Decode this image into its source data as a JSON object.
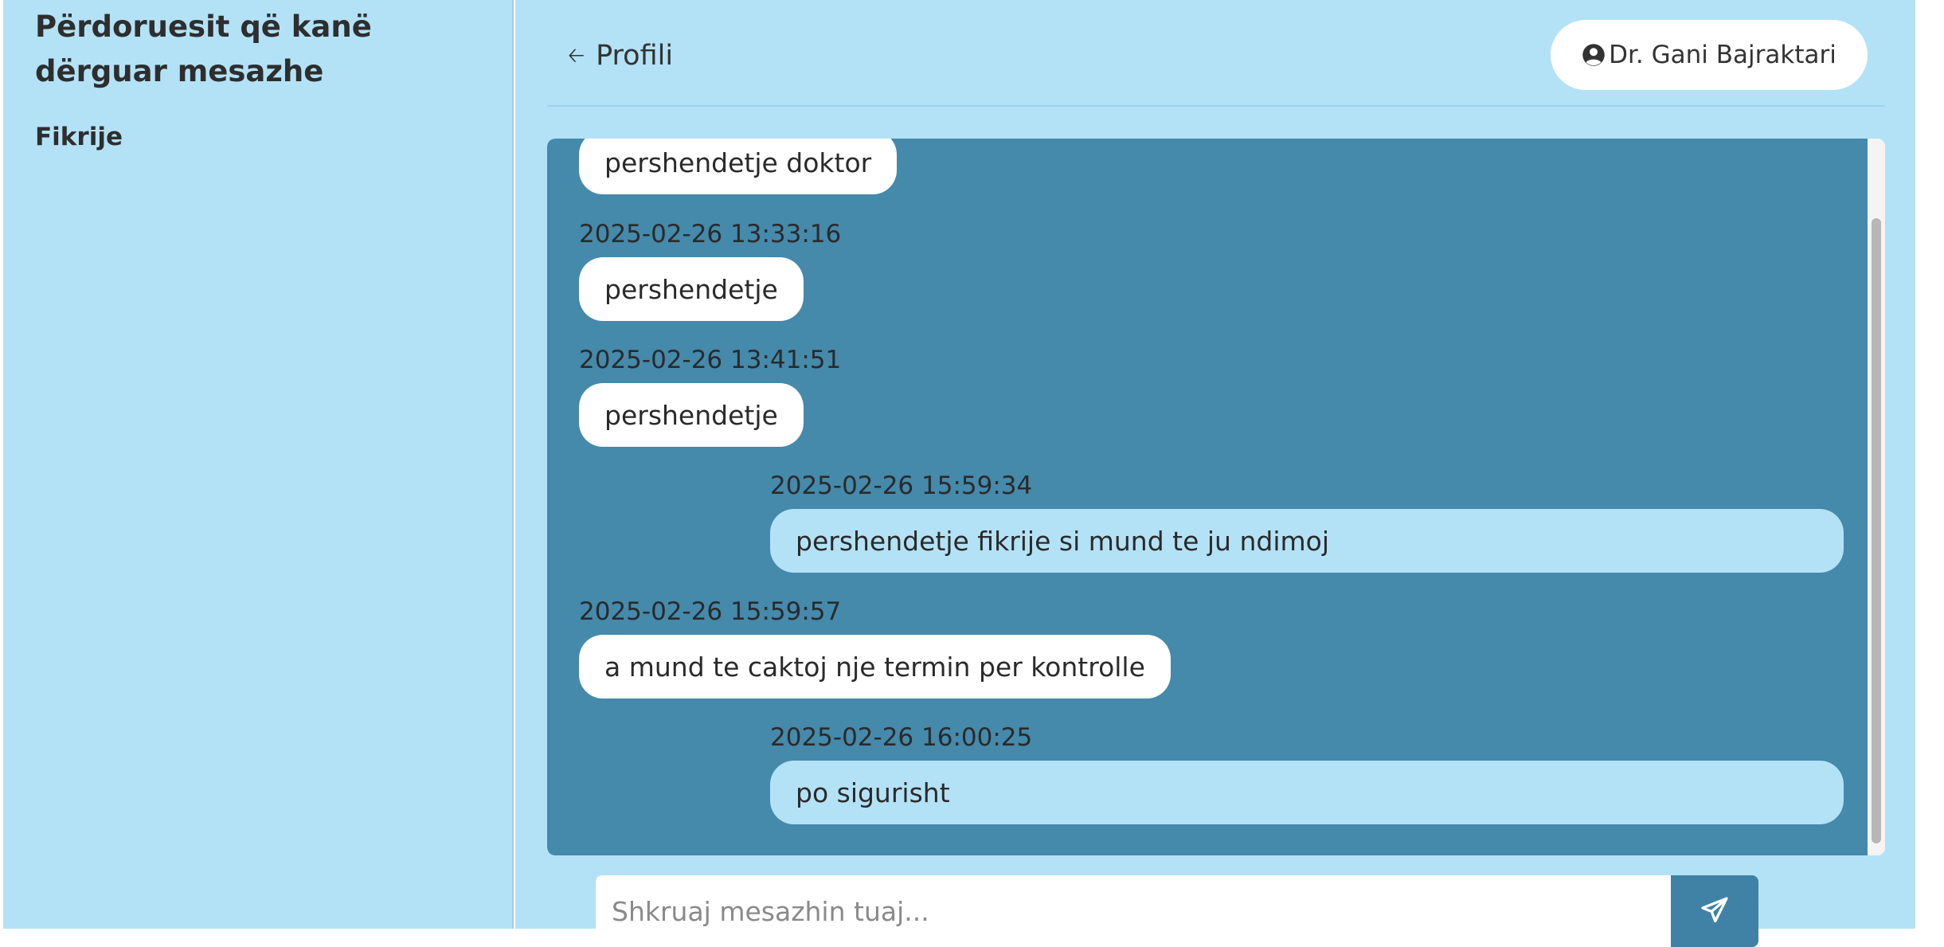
{
  "sidebar": {
    "title": "Përdoruesit që kanë dërguar mesazhe",
    "users": [
      {
        "name": "Fikrije"
      }
    ]
  },
  "header": {
    "back_label": "Profili",
    "back_icon": "arrow-left-icon",
    "doctor_name": "Dr. Gani Bajraktari",
    "doctor_icon": "user-circle-icon"
  },
  "messages": [
    {
      "direction": "in",
      "time": "",
      "text": "pershendetje doktor"
    },
    {
      "direction": "in",
      "time": "2025-02-26 13:33:16",
      "text": "pershendetje"
    },
    {
      "direction": "in",
      "time": "2025-02-26 13:41:51",
      "text": "pershendetje"
    },
    {
      "direction": "out",
      "time": "2025-02-26 15:59:34",
      "text": "pershendetje fikrije si mund te ju ndimoj"
    },
    {
      "direction": "in",
      "time": "2025-02-26 15:59:57",
      "text": "a mund te caktoj nje termin per kontrolle"
    },
    {
      "direction": "out",
      "time": "2025-02-26 16:00:25",
      "text": "po sigurisht"
    }
  ],
  "composer": {
    "placeholder": "Shkruaj mesazhin tuaj...",
    "value": "",
    "send_icon": "paper-plane-icon"
  },
  "colors": {
    "background": "#b3e2f7",
    "chat_area": "#4589ab",
    "incoming_bubble": "#ffffff",
    "outgoing_bubble": "#b3e2f7",
    "send_button": "#3f82a5"
  }
}
